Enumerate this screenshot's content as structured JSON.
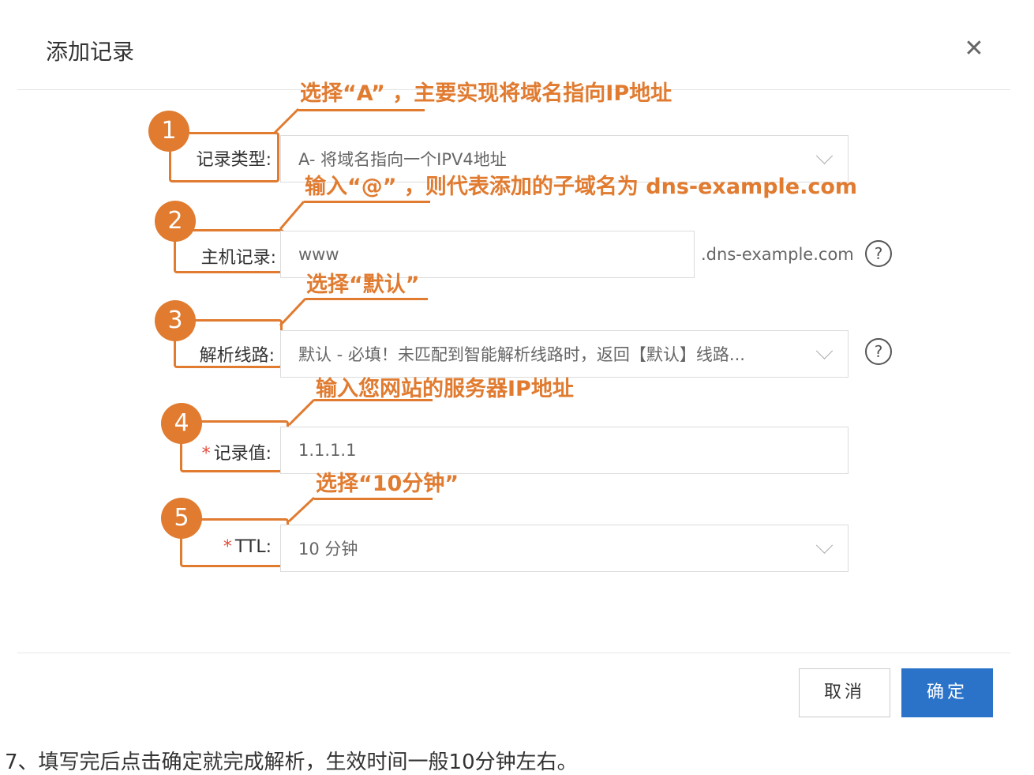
{
  "dialog": {
    "title": "添加记录",
    "close_icon": "close-icon"
  },
  "form": {
    "record_type": {
      "label": "记录类型:",
      "value": "A- 将域名指向一个IPV4地址"
    },
    "host_record": {
      "label": "主机记录:",
      "value": "www",
      "suffix": ".dns-example.com"
    },
    "resolve_line": {
      "label": "解析线路:",
      "value": "默认 - 必填！未匹配到智能解析线路时，返回【默认】线路..."
    },
    "record_value": {
      "required_mark": "*",
      "label": "记录值:",
      "value": "1.1.1.1"
    },
    "ttl": {
      "required_mark": "*",
      "label": "TTL:",
      "value": "10 分钟"
    }
  },
  "annotations": [
    {
      "number": "1",
      "text": "选择“A” ，主要实现将域名指向IP地址"
    },
    {
      "number": "2",
      "text": "输入“@” ，则代表添加的子域名为 dns-example.com"
    },
    {
      "number": "3",
      "text": "选择“默认”"
    },
    {
      "number": "4",
      "text": "输入您网站的服务器IP地址"
    },
    {
      "number": "5",
      "text": "选择“10分钟”"
    }
  ],
  "buttons": {
    "cancel": "取消",
    "ok": "确定"
  },
  "footnote": "7、填写完后点击确定就完成解析，生效时间一般10分钟左右。",
  "colors": {
    "accent": "#e07b30",
    "primary_button": "#2b73c9",
    "required": "#e34d3c"
  }
}
